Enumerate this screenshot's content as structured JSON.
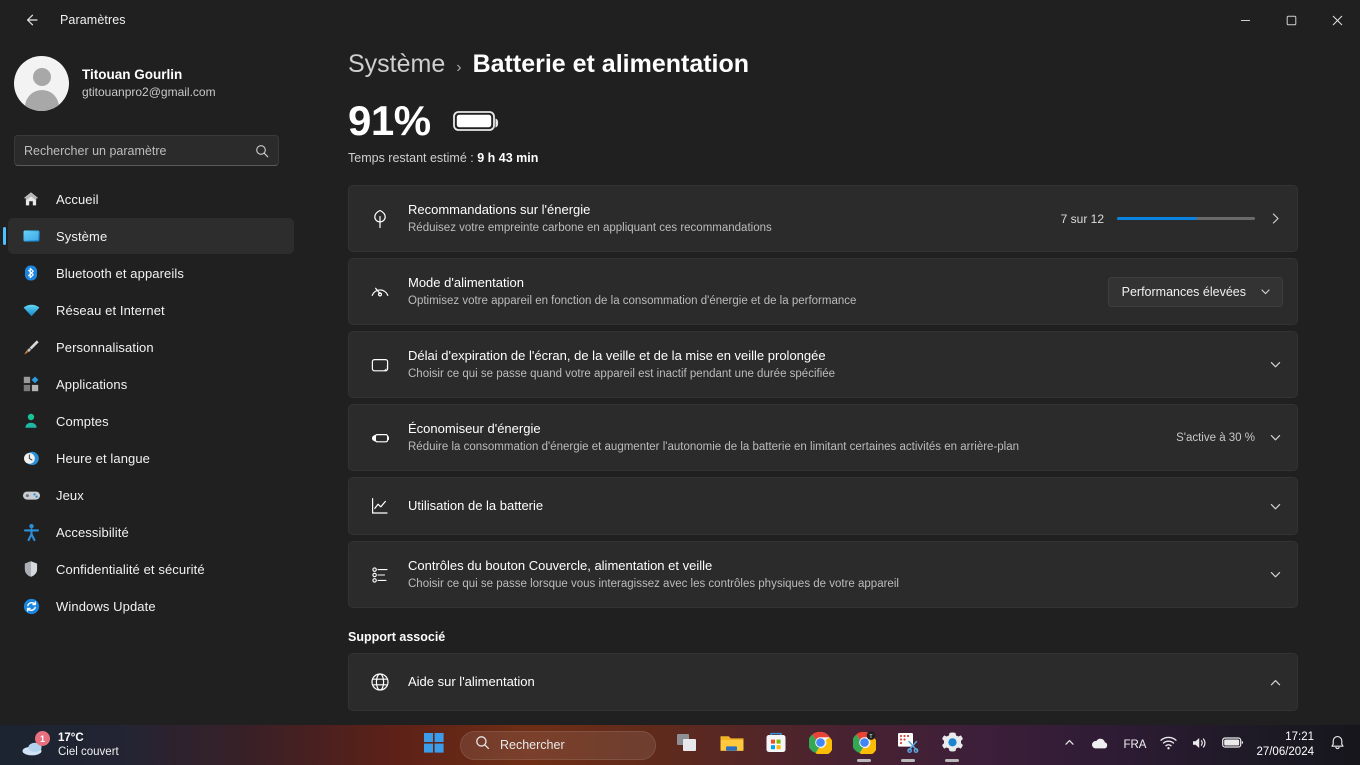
{
  "window": {
    "title": "Paramètres",
    "back_icon": "arrow-left-icon",
    "minimize_label": "—",
    "maximize_label": "▢",
    "close_label": "✕"
  },
  "sidebar": {
    "account": {
      "name": "Titouan Gourlin",
      "email": "gtitouanpro2@gmail.com",
      "avatar_icon": "person-avatar-icon"
    },
    "search": {
      "placeholder": "Rechercher un paramètre",
      "value": "",
      "icon": "search-icon"
    },
    "items": [
      {
        "label": "Accueil",
        "icon": "home-icon",
        "active": false
      },
      {
        "label": "Système",
        "icon": "display-icon",
        "active": true
      },
      {
        "label": "Bluetooth et appareils",
        "icon": "bluetooth-icon",
        "active": false
      },
      {
        "label": "Réseau et Internet",
        "icon": "wifi-icon",
        "active": false
      },
      {
        "label": "Personnalisation",
        "icon": "brush-icon",
        "active": false
      },
      {
        "label": "Applications",
        "icon": "apps-icon",
        "active": false
      },
      {
        "label": "Comptes",
        "icon": "account-icon",
        "active": false
      },
      {
        "label": "Heure et langue",
        "icon": "clock-icon",
        "active": false
      },
      {
        "label": "Jeux",
        "icon": "gamepad-icon",
        "active": false
      },
      {
        "label": "Accessibilité",
        "icon": "accessibility-icon",
        "active": false
      },
      {
        "label": "Confidentialité et sécurité",
        "icon": "shield-icon",
        "active": false
      },
      {
        "label": "Windows Update",
        "icon": "update-icon",
        "active": false
      }
    ]
  },
  "page": {
    "breadcrumb_parent": "Système",
    "breadcrumb_separator": "›",
    "breadcrumb_current": "Batterie et alimentation",
    "battery_percent": "91%",
    "battery_icon": "battery-full-icon",
    "time_remaining_label": "Temps restant estimé : ",
    "time_remaining_value": "9 h 43 min",
    "cards": [
      {
        "icon": "leaf-icon",
        "title": "Recommandations sur l'énergie",
        "subtitle": "Réduisez votre empreinte carbone en appliquant ces recommandations",
        "progress_label": "7 sur 12",
        "progress_value": 58,
        "progress_color": "#0a84e0",
        "action_icon": "chevron-right-icon"
      },
      {
        "icon": "gauge-icon",
        "title": "Mode d'alimentation",
        "subtitle": "Optimisez votre appareil en fonction de la consommation d'énergie et de la performance",
        "dropdown_value": "Performances élevées",
        "action_icon": "chevron-down-icon"
      },
      {
        "icon": "screen-sleep-icon",
        "title": "Délai d'expiration de l'écran, de la veille et de la mise en veille prolongée",
        "subtitle": "Choisir ce qui se passe quand votre appareil est inactif pendant une durée spécifiée",
        "action_icon": "chevron-down-icon"
      },
      {
        "icon": "battery-saver-icon",
        "title": "Économiseur d'énergie",
        "subtitle": "Réduire la consommation d'énergie et augmenter l'autonomie de la batterie en limitant certaines activités en arrière-plan",
        "value_text": "S'active à 30 %",
        "action_icon": "chevron-down-icon"
      },
      {
        "icon": "chart-icon",
        "title": "Utilisation de la batterie",
        "subtitle": "",
        "action_icon": "chevron-down-icon"
      },
      {
        "icon": "sliders-icon",
        "title": "Contrôles du bouton Couvercle, alimentation et veille",
        "subtitle": "Choisir ce qui se passe lorsque vous interagissez avec les contrôles physiques de votre appareil",
        "action_icon": "chevron-down-icon"
      }
    ],
    "support_section_title": "Support associé",
    "support_card": {
      "icon": "globe-icon",
      "title": "Aide sur l'alimentation",
      "action_icon": "chevron-up-icon"
    }
  },
  "taskbar": {
    "weather": {
      "temperature": "17°C",
      "description": "Ciel couvert",
      "badge": "1",
      "icon": "cloud-icon"
    },
    "start_icon": "windows-start-icon",
    "search": {
      "label": "Rechercher",
      "icon": "search-icon"
    },
    "apps": [
      {
        "name": "task-view-icon",
        "running": false
      },
      {
        "name": "file-explorer-icon",
        "running": false
      },
      {
        "name": "microsoft-store-icon",
        "running": false
      },
      {
        "name": "chrome-icon",
        "running": false
      },
      {
        "name": "chrome-beta-icon",
        "running": true
      },
      {
        "name": "snipping-tool-icon",
        "running": true
      },
      {
        "name": "settings-icon",
        "running": true
      }
    ],
    "tray": {
      "overflow_icon": "chevron-up-icon",
      "onedrive_icon": "cloud-icon",
      "language": "FRA",
      "wifi_icon": "wifi-icon",
      "volume_icon": "speaker-icon",
      "battery_icon": "battery-icon",
      "time": "17:21",
      "date": "27/06/2024",
      "notification_icon": "bell-icon"
    }
  }
}
